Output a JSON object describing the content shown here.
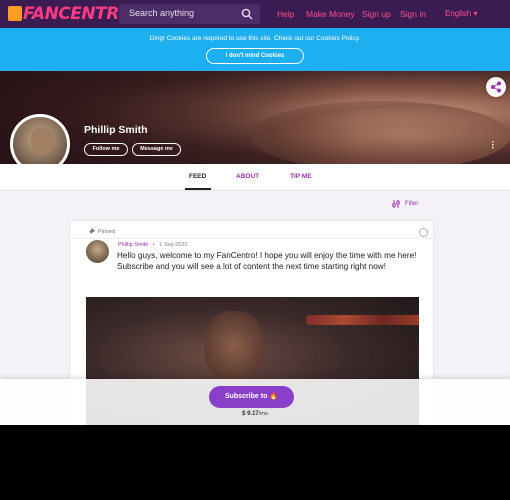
{
  "nav": {
    "logo": "FANCENTRO",
    "search_placeholder": "Search anything",
    "links": [
      "Help",
      "Make Money",
      "Sign up",
      "Sign in"
    ],
    "language": "English ▾"
  },
  "cookie": {
    "message": "Ding! Cookies are required to use this site. Check out our Cookies Policy.",
    "button": "I don't mind Cookies"
  },
  "profile": {
    "name": "Phillip Smith",
    "follow_label": "Follow me",
    "message_label": "Message me"
  },
  "tabs": [
    "FEED",
    "ABOUT",
    "TIP ME"
  ],
  "filter_label": "Filter",
  "post": {
    "pinned_label": "Pinned",
    "author": "Phillip Smith",
    "separator": "•",
    "date": "1 Sep 2020",
    "text": "Hello guys, welcome to my FanCentro! I hope you will enjoy the time with me here! Subscribe and you will see a lot of content the next time starting right now!"
  },
  "subscribe": {
    "label": "Subscribe to",
    "emoji": "🔥",
    "price": "$ 9.17",
    "period": "/mo"
  },
  "colors": {
    "nav_bg": "#3a1c52",
    "accent_pink": "#ff4d8d",
    "cookie_bg": "#1eaff0",
    "purple": "#9b2fae",
    "subscribe_btn": "#8a3fc8"
  }
}
